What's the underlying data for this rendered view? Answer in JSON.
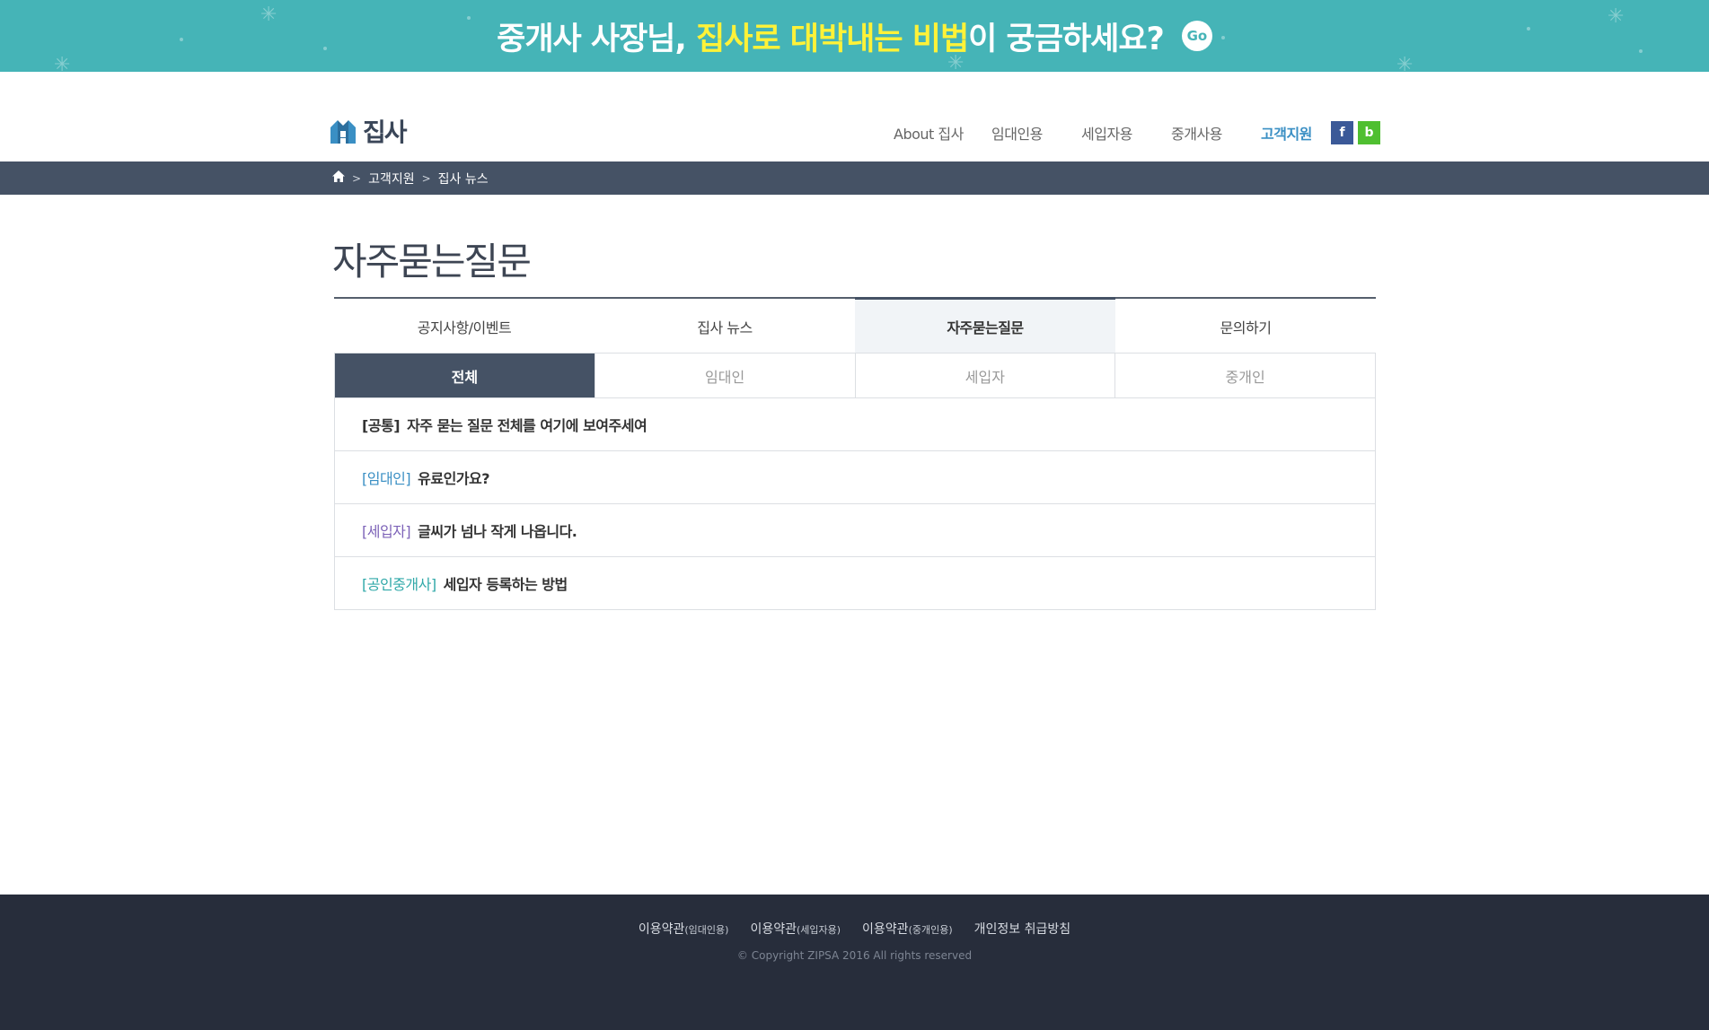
{
  "banner": {
    "text_pre": "중개사 사장님, ",
    "text_highlight": "집사로 대박내는 비법",
    "text_post": "이 궁금하세요?",
    "go_label": "Go"
  },
  "header": {
    "logo_text": "집사",
    "nav": [
      {
        "label": "About 집사",
        "active": false
      },
      {
        "label": "임대인용",
        "active": false
      },
      {
        "label": "세입자용",
        "active": false
      },
      {
        "label": "중개사용",
        "active": false
      },
      {
        "label": "고객지원",
        "active": true
      }
    ],
    "sns": {
      "facebook": "f",
      "blog": "b"
    }
  },
  "breadcrumb": {
    "home_icon": "home-icon",
    "items": [
      "고객지원",
      "집사 뉴스"
    ],
    "separator": ">"
  },
  "page_title": "자주묻는질문",
  "main_tabs": [
    {
      "label": "공지사항/이벤트",
      "active": false
    },
    {
      "label": "집사 뉴스",
      "active": false
    },
    {
      "label": "자주묻는질문",
      "active": true
    },
    {
      "label": "문의하기",
      "active": false
    }
  ],
  "sub_tabs": [
    {
      "label": "전체",
      "active": true
    },
    {
      "label": "임대인",
      "active": false
    },
    {
      "label": "세입자",
      "active": false
    },
    {
      "label": "중개인",
      "active": false
    }
  ],
  "faq": [
    {
      "category": "[공통]",
      "category_color": "#333333",
      "question": "자주 묻는 질문 전체를 여기에 보여주세여"
    },
    {
      "category": "[임대인]",
      "category_color": "#3a8fc4",
      "question": "유료인가요?"
    },
    {
      "category": "[세입자]",
      "category_color": "#7d63b8",
      "question": "글씨가 넘나 작게 나옵니다."
    },
    {
      "category": "[공인중개사]",
      "category_color": "#2fa8a8",
      "question": "세입자 등록하는 방법"
    }
  ],
  "footer": {
    "links": [
      {
        "main": "이용약관",
        "sub": "(임대인용)"
      },
      {
        "main": "이용약관",
        "sub": "(세입자용)"
      },
      {
        "main": "이용약관",
        "sub": "(중개인용)"
      },
      {
        "main": "개인정보 취급방침",
        "sub": ""
      }
    ],
    "copyright": "© Copyright ZIPSA 2016 All rights reserved"
  },
  "colors": {
    "banner_bg": "#45b4b7",
    "banner_highlight": "#fff238",
    "nav_active": "#3a8fc4",
    "breadcrumb_bg": "#455265",
    "footer_bg": "#272d3b"
  }
}
